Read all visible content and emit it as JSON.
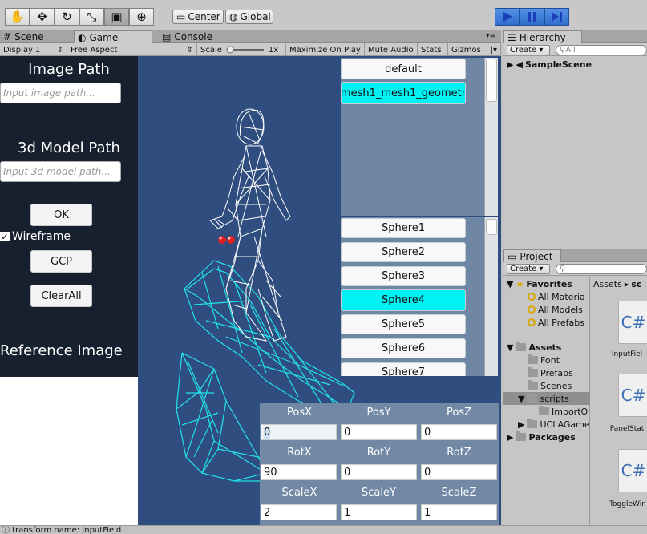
{
  "toolbar": {
    "tools": [
      "hand-tool",
      "move-tool",
      "rotate-tool",
      "scale-tool",
      "rect-tool",
      "transform-tool"
    ],
    "pivot_label": "Center",
    "space_label": "Global",
    "colors": {
      "play": "#2f6fcc"
    }
  },
  "tabs": {
    "scene": "Scene",
    "game": "Game",
    "console": "Console",
    "hierarchy": "Hierarchy",
    "project": "Project"
  },
  "game_toolbar": {
    "display": "Display 1",
    "aspect": "Free Aspect",
    "scale_label": "Scale",
    "scale_value": "1x",
    "maximize": "Maximize On Play",
    "mute": "Mute Audio",
    "stats": "Stats",
    "gizmos": "Gizmos"
  },
  "left_panel": {
    "image_path_title": "Image Path",
    "image_path_placeholder": "Input image path...",
    "model_path_title": "3d Model Path",
    "model_path_placeholder": "Input 3d model path...",
    "ok": "OK",
    "wireframe": "Wireframe",
    "gcp": "GCP",
    "clear_all": "ClearAll",
    "reference_image": "Reference Image"
  },
  "mesh_list": [
    "default",
    "mesh1_mesh1_geometr"
  ],
  "sphere_list": [
    "Sphere1",
    "Sphere2",
    "Sphere3",
    "Sphere4",
    "Sphere5",
    "Sphere6",
    "Sphere7"
  ],
  "transform": {
    "labels": [
      "PosX",
      "PosY",
      "PosZ",
      "RotX",
      "RotY",
      "RotZ",
      "ScaleX",
      "ScaleY",
      "ScaleZ"
    ],
    "values": [
      "0",
      "0",
      "0",
      "90",
      "0",
      "0",
      "2",
      "1",
      "1"
    ]
  },
  "hierarchy": {
    "create": "Create",
    "search": "All",
    "scene": "SampleScene"
  },
  "project": {
    "create": "Create",
    "favorites": "Favorites",
    "fav_items": [
      "All Materia",
      "All Models",
      "All Prefabs"
    ],
    "assets": "Assets",
    "asset_items": [
      "Font",
      "Prefabs",
      "Scenes",
      "scripts",
      "ImportO",
      "UCLAGame"
    ],
    "packages": "Packages",
    "breadcrumb": "Assets",
    "breadcrumb_next": "sc",
    "files": [
      "InputFiel",
      "PanelStat",
      "ToggleWir"
    ]
  },
  "status_text": "transform name: InputField"
}
